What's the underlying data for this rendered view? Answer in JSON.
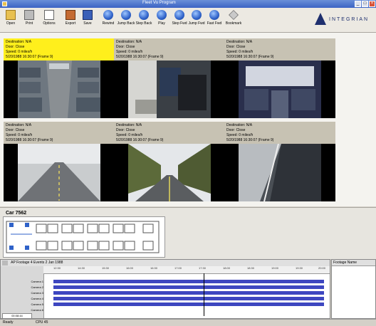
{
  "window": {
    "title": "Fleet Vu Program"
  },
  "toolbar": {
    "buttons": [
      "Open",
      "Print",
      "Options",
      "Export",
      "Save",
      "Rewind",
      "Jump Back",
      "Step Back",
      "Play",
      "Step Fwd",
      "Jump Fwd",
      "Fast Fwd",
      "Bookmark"
    ]
  },
  "logo": {
    "word": "INTEGRIAN"
  },
  "cameras": [
    {
      "l1": "Destination: N/A",
      "l2": "Door: Close",
      "l3": "Speed: 0 miles/h",
      "l4": "5/20/1988 16:30:07 (Frame 9)"
    },
    {
      "l1": "Destination: N/A",
      "l2": "Door: Close",
      "l3": "Speed: 0 miles/h",
      "l4": "5/20/1988 16:30:07 (Frame 9)"
    },
    {
      "l1": "Destination: N/A",
      "l2": "Door: Close",
      "l3": "Speed: 0 miles/h",
      "l4": "5/20/1988 16:30:07 (Frame 9)"
    },
    {
      "l1": "Destination: N/A",
      "l2": "Door: Close",
      "l3": "Speed: 0 miles/h",
      "l4": "5/20/1988 16:30:07 (Frame 9)"
    },
    {
      "l1": "Destination: N/A",
      "l2": "Door: Close",
      "l3": "Speed: 0 miles/h",
      "l4": "5/20/1988 16:30:07 (Frame 9)"
    },
    {
      "l1": "Destination: N/A",
      "l2": "Door: Close",
      "l3": "Speed: 0 miles/h",
      "l4": "5/20/1988 16:30:07 (Frame 9)"
    }
  ],
  "car": {
    "title": "Car 7562"
  },
  "timeline": {
    "header": "AP Footage 4 Events 2 Jan 1988",
    "ticks": [
      "12:30",
      "14:30",
      "15:30",
      "16:00",
      "16:30",
      "17:00",
      "17:30",
      "18:00",
      "18:30",
      "19:00",
      "19:30",
      "20:00"
    ],
    "tracks": [
      "Camera 1",
      "Camera 2",
      "Camera 3",
      "Camera 4",
      "Camera 5",
      "Camera 6"
    ],
    "time_box": "00:08:44"
  },
  "right_panel": {
    "header": "Footage Name"
  },
  "status": {
    "left": "Ready",
    "mid": "CPU 45"
  },
  "colors": {
    "selected_header": "#ffef1c",
    "track_bar": "#3d46c0",
    "accent_blue": "#2f62c9"
  }
}
